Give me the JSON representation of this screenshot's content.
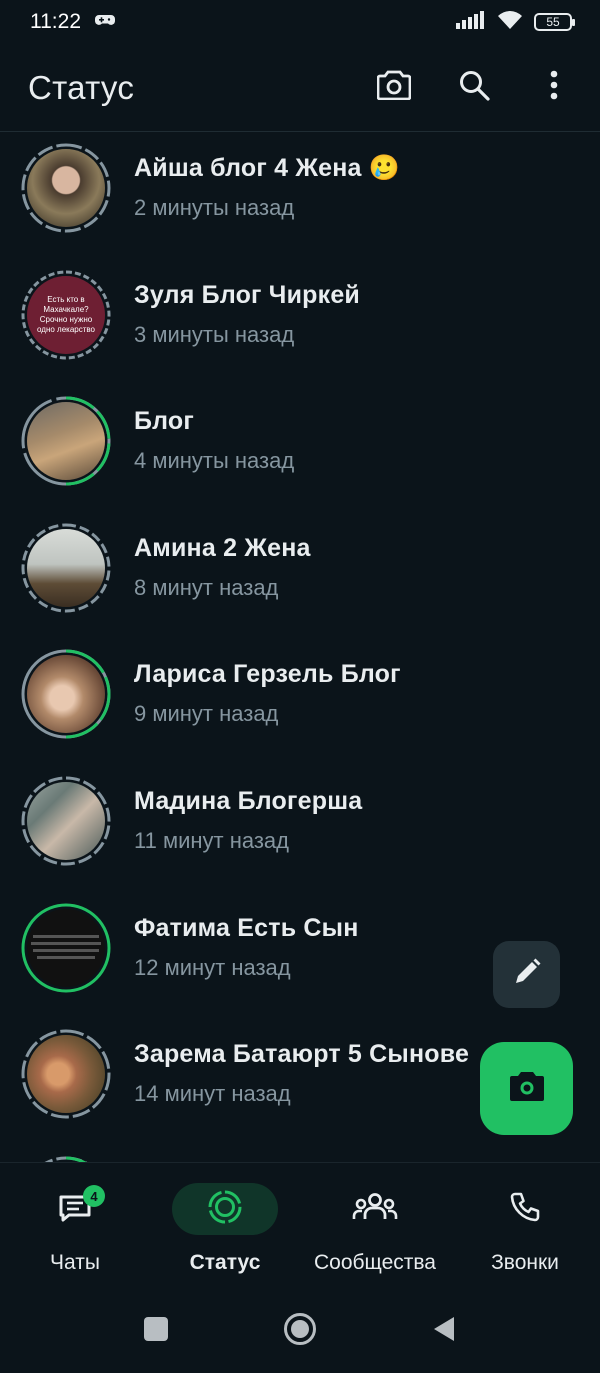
{
  "status_bar": {
    "time": "11:22",
    "battery": "55"
  },
  "header": {
    "title": "Статус"
  },
  "statuses": [
    {
      "name": "Айша блог 4 Жена 🥲",
      "time": "2 минуты назад"
    },
    {
      "name": "Зуля Блог Чиркей",
      "time": "3 минуты назад",
      "thumb_text": "Есть кто в Махачкале? Срочно нужно одно лекарство"
    },
    {
      "name": "Блог",
      "time": "4 минуты назад"
    },
    {
      "name": "Амина 2 Жена",
      "time": "8 минут назад"
    },
    {
      "name": "Лариса Герзель Блог",
      "time": "9 минут назад"
    },
    {
      "name": "Мадина Блогерша",
      "time": "11 минут назад"
    },
    {
      "name": "Фатима Есть Сын",
      "time": "12 минут назад"
    },
    {
      "name": "Зарема Батаюрт 5 Сынове",
      "time": "14 минут назад"
    }
  ],
  "bottom_nav": {
    "chats": {
      "label": "Чаты",
      "badge": "4"
    },
    "status": {
      "label": "Статус"
    },
    "communities": {
      "label": "Сообщества"
    },
    "calls": {
      "label": "Звонки"
    }
  },
  "colors": {
    "background": "#0b141a",
    "accent": "#21c063",
    "secondary_text": "#8696a0"
  }
}
